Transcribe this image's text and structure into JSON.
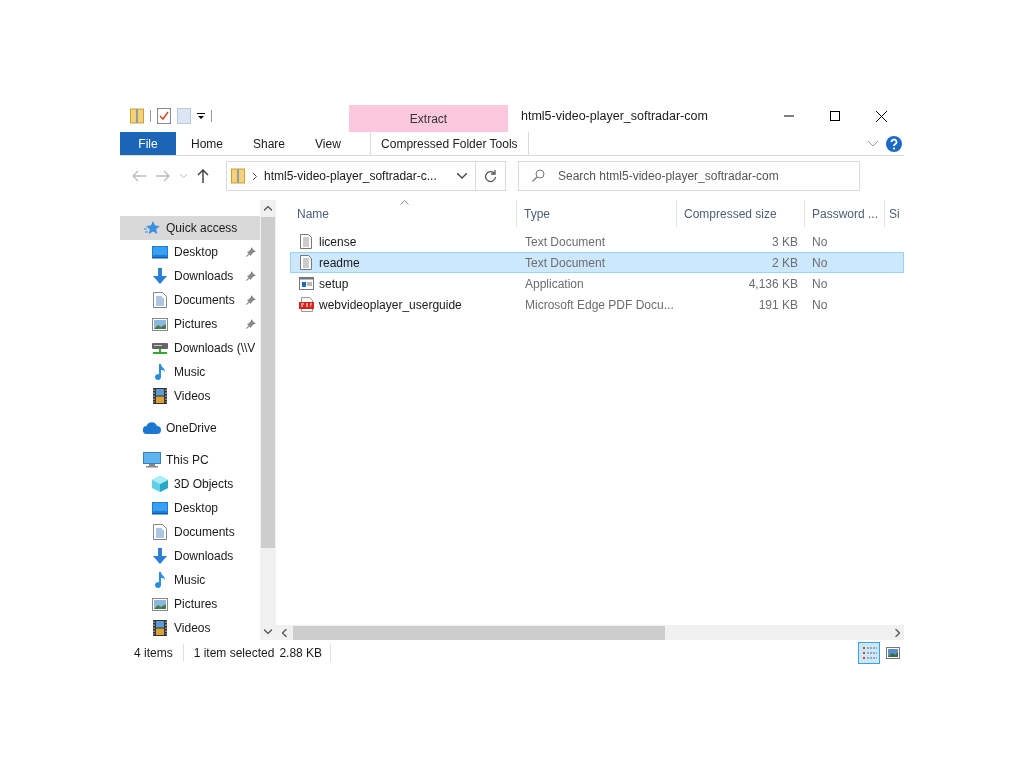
{
  "window": {
    "title": "html5-video-player_softradar-com"
  },
  "ribbon": {
    "context_tab": "Extract",
    "context_group": "Compressed Folder Tools",
    "tabs": [
      {
        "label": "File",
        "kind": "file",
        "selected": false
      },
      {
        "label": "Home",
        "kind": "plain",
        "selected": false
      },
      {
        "label": "Share",
        "kind": "plain",
        "selected": false
      },
      {
        "label": "View",
        "kind": "plain",
        "selected": false
      }
    ]
  },
  "address": {
    "path": "html5-video-player_softradar-c...",
    "search_placeholder": "Search html5-video-player_softradar-com"
  },
  "sidebar": {
    "items": [
      {
        "label": "Quick access",
        "kind": "star",
        "selected": true,
        "children": [
          {
            "label": "Desktop",
            "kind": "desktop",
            "pinned": true,
            "selected": false
          },
          {
            "label": "Downloads",
            "kind": "download",
            "pinned": true,
            "selected": false
          },
          {
            "label": "Documents",
            "kind": "document",
            "pinned": true,
            "selected": false
          },
          {
            "label": "Pictures",
            "kind": "picture",
            "pinned": true,
            "selected": false
          },
          {
            "label": "Downloads (\\\\V",
            "kind": "drive",
            "pinned": false,
            "selected": false
          },
          {
            "label": "Music",
            "kind": "music",
            "pinned": false,
            "selected": false
          },
          {
            "label": "Videos",
            "kind": "video",
            "pinned": false,
            "selected": false
          }
        ]
      },
      {
        "label": "OneDrive",
        "kind": "cloud",
        "selected": false
      },
      {
        "label": "This PC",
        "kind": "pc",
        "selected": false,
        "children": [
          {
            "label": "3D Objects",
            "kind": "cube",
            "pinned": false,
            "selected": false
          },
          {
            "label": "Desktop",
            "kind": "desktop",
            "pinned": false,
            "selected": false
          },
          {
            "label": "Documents",
            "kind": "document",
            "pinned": false,
            "selected": false
          },
          {
            "label": "Downloads",
            "kind": "download",
            "pinned": false,
            "selected": false
          },
          {
            "label": "Music",
            "kind": "music",
            "pinned": false,
            "selected": false
          },
          {
            "label": "Pictures",
            "kind": "picture",
            "pinned": false,
            "selected": false
          },
          {
            "label": "Videos",
            "kind": "video",
            "pinned": false,
            "selected": false
          }
        ]
      }
    ]
  },
  "table": {
    "columns": [
      "Name",
      "Type",
      "Compressed size",
      "Password ...",
      "Si"
    ],
    "rows": [
      {
        "kind": "text",
        "name": "license",
        "type": "Text Document",
        "size": "3 KB",
        "password": "No",
        "selected": false
      },
      {
        "kind": "text",
        "name": "readme",
        "type": "Text Document",
        "size": "2 KB",
        "password": "No",
        "selected": true
      },
      {
        "kind": "app",
        "name": "setup",
        "type": "Application",
        "size": "4,136 KB",
        "password": "No",
        "selected": false
      },
      {
        "kind": "pdf",
        "name": "webvideoplayer_userguide",
        "type": "Microsoft Edge PDF Docu...",
        "size": "191 KB",
        "password": "No",
        "selected": false
      }
    ]
  },
  "status_bar": {
    "count": "4 items",
    "selection": "1 item selected",
    "size": "2.88 KB"
  }
}
